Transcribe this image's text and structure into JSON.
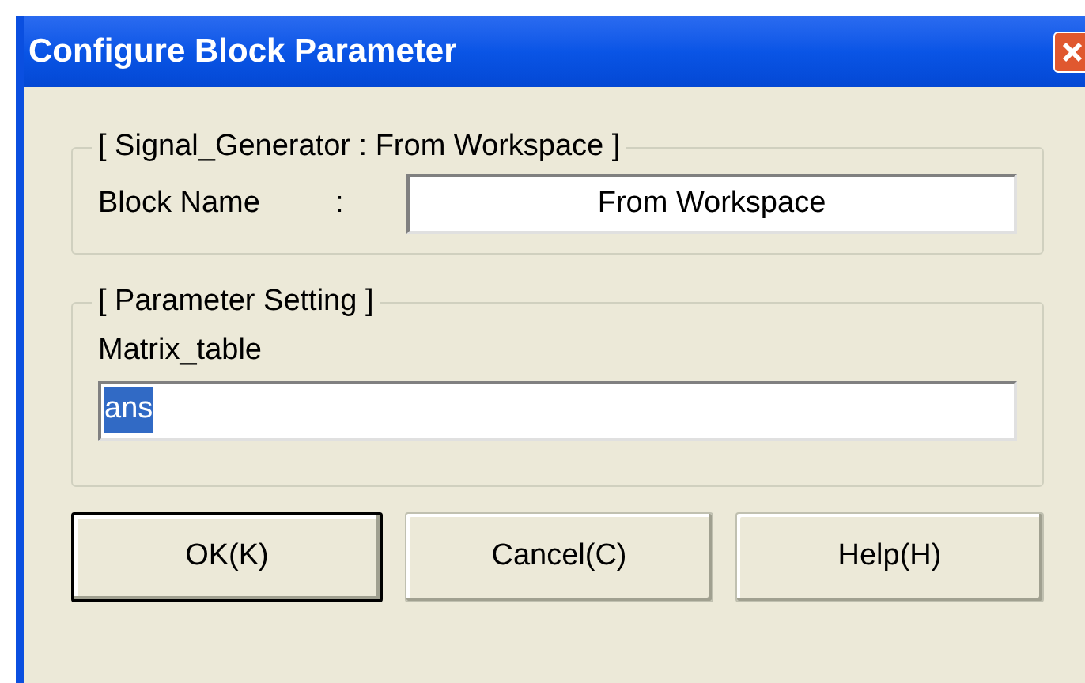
{
  "window": {
    "title": "Configure Block Parameter"
  },
  "block_group": {
    "title": "[ Signal_Generator : From Workspace ]",
    "label": "Block Name",
    "separator": ":",
    "value": "From Workspace"
  },
  "parameter_group": {
    "title": "[ Parameter Setting ]",
    "label": "Matrix_table",
    "value": "ans",
    "text_selected": true
  },
  "buttons": [
    {
      "label": "OK(K)",
      "default": true
    },
    {
      "label": "Cancel(C)",
      "default": false
    },
    {
      "label": "Help(H)",
      "default": false
    }
  ]
}
